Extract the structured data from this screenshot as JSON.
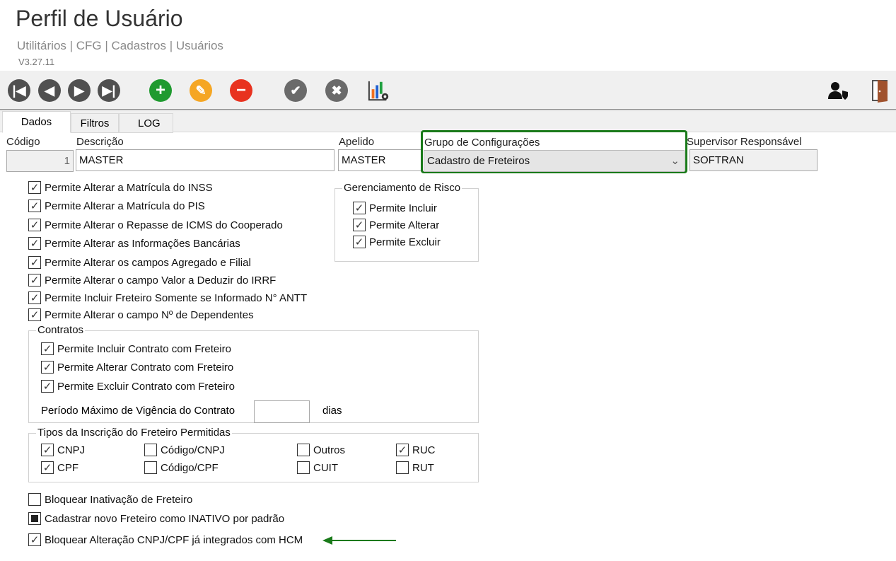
{
  "header": {
    "title": "Perfil de Usuário",
    "breadcrumb": "Utilitários | CFG | Cadastros | Usuários",
    "version": "V3.27.11"
  },
  "toolbar": {
    "icons": [
      "first-icon",
      "previous-icon",
      "next-icon",
      "last-icon",
      "add-icon",
      "edit-icon",
      "delete-icon",
      "confirm-icon",
      "cancel-icon",
      "chart-settings-icon",
      "user-permission-icon",
      "exit-door-icon"
    ],
    "colors": {
      "nav": "#505050",
      "add": "#1f9a2f",
      "edit": "#f5a623",
      "delete": "#e8321f",
      "confirm": "#6a6a6a"
    }
  },
  "tabs": [
    "Dados",
    "Filtros",
    "LOG"
  ],
  "fields": {
    "codigo": {
      "label": "Código",
      "value": "1"
    },
    "descricao": {
      "label": "Descrição",
      "value": "MASTER"
    },
    "apelido": {
      "label": "Apelido",
      "value": "MASTER"
    },
    "grupo": {
      "label": "Grupo de Configurações",
      "value": "Cadastro de Freteiros"
    },
    "supervisor": {
      "label": "Supervisor Responsável",
      "value": "SOFTRAN"
    }
  },
  "permissions": [
    {
      "label": "Permite Alterar a Matrícula do INSS",
      "checked": true
    },
    {
      "label": "Permite Alterar a Matrícula do PIS",
      "checked": true
    },
    {
      "label": "Permite Alterar o Repasse de ICMS do Cooperado",
      "checked": true
    },
    {
      "label": "Permite Alterar as Informações Bancárias",
      "checked": true
    },
    {
      "label": "Permite Alterar os campos Agregado e Filial",
      "checked": true
    },
    {
      "label": "Permite Alterar o campo Valor a Deduzir do IRRF",
      "checked": true
    },
    {
      "label": "Permite Incluir Freteiro Somente se Informado N° ANTT",
      "checked": true
    },
    {
      "label": "Permite Alterar o campo Nº de Dependentes",
      "checked": true
    }
  ],
  "risco": {
    "title": "Gerenciamento de Risco",
    "items": [
      {
        "label": "Permite Incluir",
        "checked": true
      },
      {
        "label": "Permite Alterar",
        "checked": true
      },
      {
        "label": "Permite Excluir",
        "checked": true
      }
    ]
  },
  "contratos": {
    "title": "Contratos",
    "items": [
      {
        "label": "Permite Incluir Contrato com Freteiro",
        "checked": true
      },
      {
        "label": "Permite Alterar Contrato com Freteiro",
        "checked": true
      },
      {
        "label": "Permite Excluir Contrato com Freteiro",
        "checked": true
      }
    ],
    "periodo_label": "Período Máximo de Vigência do Contrato",
    "periodo_value": "",
    "dias": "dias"
  },
  "tipos": {
    "title": "Tipos da Inscrição do Freteiro Permitidas",
    "items": [
      {
        "label": "CNPJ",
        "checked": true
      },
      {
        "label": "Código/CNPJ",
        "checked": false
      },
      {
        "label": "Outros",
        "checked": false
      },
      {
        "label": "RUC",
        "checked": true
      },
      {
        "label": "CPF",
        "checked": true
      },
      {
        "label": "Código/CPF",
        "checked": false
      },
      {
        "label": "CUIT",
        "checked": false
      },
      {
        "label": "RUT",
        "checked": false
      }
    ]
  },
  "bottom": [
    {
      "label": "Bloquear Inativação de Freteiro",
      "state": "unchecked"
    },
    {
      "label": "Cadastrar novo Freteiro como INATIVO por padrão",
      "state": "indeterminate"
    },
    {
      "label": "Bloquear Alteração CNPJ/CPF já integrados com HCM",
      "state": "checked"
    }
  ],
  "highlight_color": "#1a7a1a"
}
